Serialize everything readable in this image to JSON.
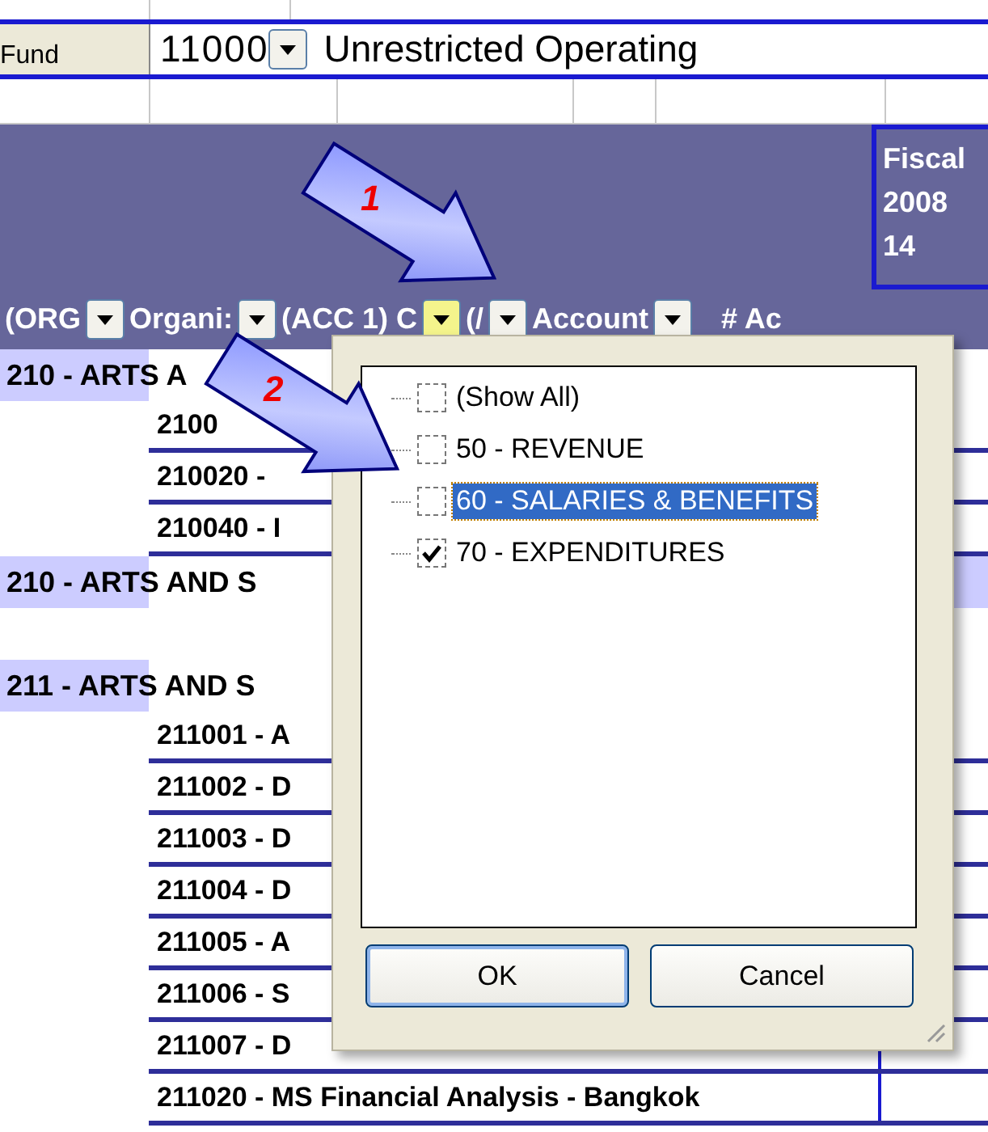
{
  "fund": {
    "label": "Fund",
    "code": "11000",
    "name": "Unrestricted Operating"
  },
  "header": {
    "lines": [
      "Fiscal",
      "2008",
      "14"
    ]
  },
  "columns": [
    {
      "label": "(ORG",
      "active": false
    },
    {
      "label": "Organi:",
      "active": false
    },
    {
      "label": "(ACC 1) C",
      "active": true
    },
    {
      "label": "(/",
      "active": false
    },
    {
      "label": "Account",
      "active": false
    },
    {
      "label": "# Ac"
    }
  ],
  "rows": [
    {
      "kind": "group",
      "text": "210 - ARTS A"
    },
    {
      "kind": "item",
      "text": "2100"
    },
    {
      "kind": "item",
      "text": "210020 -"
    },
    {
      "kind": "item",
      "text": "210040 - I"
    },
    {
      "kind": "total",
      "text": "210 - ARTS AND S"
    },
    {
      "kind": "blank"
    },
    {
      "kind": "group",
      "text": "211 - ARTS AND S"
    },
    {
      "kind": "item",
      "text": "211001 - A"
    },
    {
      "kind": "item",
      "text": "211002 - D"
    },
    {
      "kind": "item",
      "text": "211003 - D"
    },
    {
      "kind": "item",
      "text": "211004 - D"
    },
    {
      "kind": "item",
      "text": "211005 - A"
    },
    {
      "kind": "item",
      "text": "211006 - S"
    },
    {
      "kind": "item",
      "text": "211007 - D"
    },
    {
      "kind": "item",
      "text": "211020 - MS Financial Analysis - Bangkok"
    }
  ],
  "filter_popup": {
    "options": [
      {
        "label": "(Show All)",
        "checked": false,
        "selected": false
      },
      {
        "label": "50 - REVENUE",
        "checked": false,
        "selected": false
      },
      {
        "label": "60 - SALARIES & BENEFITS",
        "checked": false,
        "selected": true
      },
      {
        "label": "70 - EXPENDITURES",
        "checked": true,
        "selected": false
      }
    ],
    "buttons": [
      "OK",
      "Cancel"
    ]
  },
  "callouts": [
    "1",
    "2"
  ]
}
